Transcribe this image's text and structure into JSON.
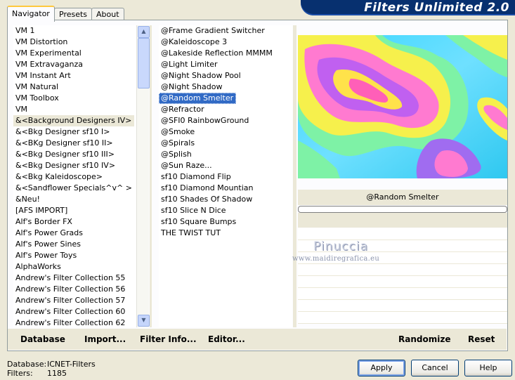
{
  "banner": {
    "title": "Filters Unlimited 2.0",
    "color": "#07306f"
  },
  "tabs": [
    {
      "label": "Navigator"
    },
    {
      "label": "Presets"
    },
    {
      "label": "About"
    }
  ],
  "categories": [
    "VM 1",
    "VM Distortion",
    "VM Experimental",
    "VM Extravaganza",
    "VM Instant Art",
    "VM Natural",
    "VM Toolbox",
    "VM",
    "&<Background Designers IV>",
    "&<Bkg Designer sf10 I>",
    "&<BKg Designer sf10 II>",
    "&<Bkg Designer sf10 III>",
    "&<Bkg Designer sf10 IV>",
    "&<Bkg Kaleidoscope>",
    "&<Sandflower Specials^v^ >",
    "&Neu!",
    "[AFS IMPORT]",
    "Alf's Border FX",
    "Alf's Power Grads",
    "Alf's Power Sines",
    "Alf's Power Toys",
    "AlphaWorks",
    "Andrew's Filter Collection 55",
    "Andrew's Filter Collection 56",
    "Andrew's Filter Collection 57",
    "Andrew's Filter Collection 60",
    "Andrew's Filter Collection 62"
  ],
  "filters": [
    "@Frame Gradient Switcher",
    "@Kaleidoscope 3",
    "@Lakeside Reflection MMMM",
    "@Light Limiter",
    "@Night Shadow Pool",
    "@Night Shadow",
    "@Random Smelter",
    "@Refractor",
    "@SFI0 RainbowGround",
    "@Smoke",
    "@Spirals",
    "@Splish",
    "@Sun Raze...",
    "sf10 Diamond Flip",
    "sf10 Diamond Mountian",
    "sf10 Shades Of Shadow",
    "sf10 Slice N Dice",
    "sf10 Square Bumps",
    "THE TWIST TUT"
  ],
  "selected_filter": "@Random Smelter",
  "watermark": {
    "line1": "Pinuccia",
    "line2": "www.maidiregrafica.eu"
  },
  "bottom_buttons": {
    "database": "Database",
    "import": "Import...",
    "filter_info": "Filter Info...",
    "editor": "Editor...",
    "randomize": "Randomize",
    "reset": "Reset"
  },
  "status": {
    "database_label": "Database:",
    "database_value": "ICNET-Filters",
    "filters_label": "Filters:",
    "filters_value": "1185"
  },
  "dialog_buttons": {
    "apply": "Apply",
    "cancel": "Cancel",
    "help": "Help"
  }
}
